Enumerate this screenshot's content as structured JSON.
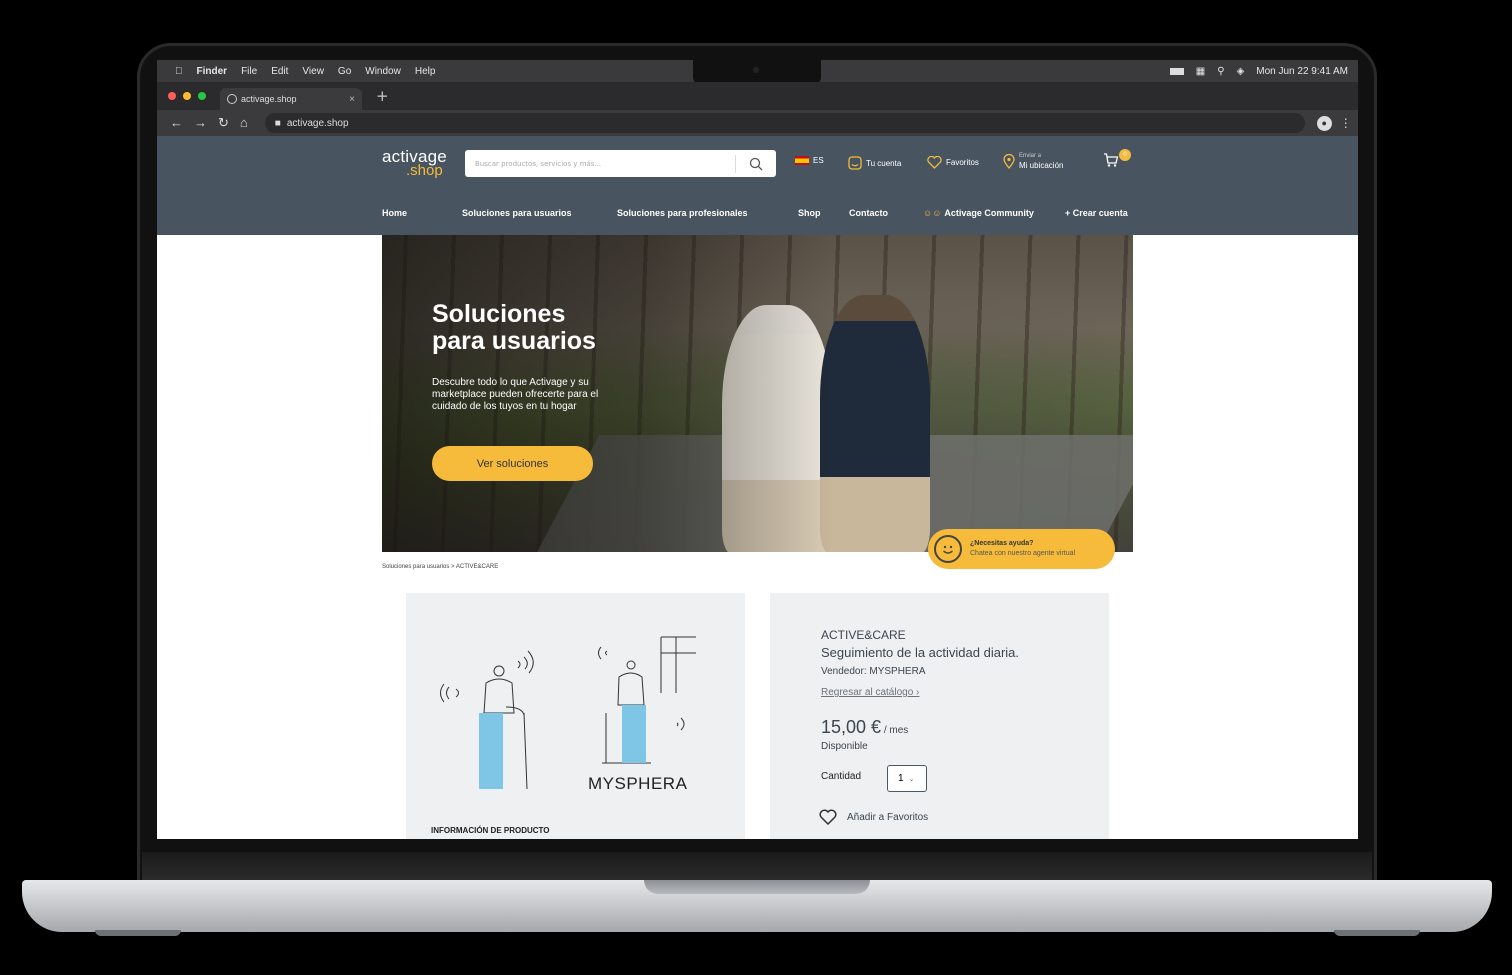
{
  "mac_menubar": {
    "app": "Finder",
    "menus": [
      "File",
      "Edit",
      "View",
      "Go",
      "Window",
      "Help"
    ],
    "clock": "Mon Jun 22  9:41 AM"
  },
  "browser": {
    "tab_title": "activage.shop",
    "url": "activage.shop"
  },
  "site": {
    "logo_line1": "activage",
    "logo_line2": ".shop",
    "search_placeholder": "Buscar productos, servicios y más...",
    "lang": "ES",
    "account": "Tu cuenta",
    "favorites": "Favoritos",
    "location_small": "Enviar a",
    "location": "Mi ubicación",
    "cart_count": "0",
    "nav": [
      "Home",
      "Soluciones para usuarios",
      "Soluciones para profesionales",
      "Shop",
      "Contacto",
      "Activage Community",
      "+ Crear cuenta"
    ]
  },
  "hero": {
    "title_line1": "Soluciones",
    "title_line2": "para usuarios",
    "description": "Descubre todo lo que Activage y su marketplace pueden ofrecerte para el cuidado de los tuyos en tu hogar",
    "cta": "Ver soluciones"
  },
  "help_widget": {
    "title": "¿Necesitas ayuda?",
    "subtitle": "Chatea con nuestro agente virtual"
  },
  "breadcrumb": "Soluciones para usuarios > ACTIVE&CARE",
  "product": {
    "brand_logo": "MYSPHERA",
    "info_heading": "INFORMACIÓN DE PRODUCTO",
    "name": "ACTIVE&CARE",
    "subtitle": "Seguimiento de la actividad diaria.",
    "vendor": "Vendedor: MYSPHERA",
    "back_link": "Regresar al catálogo ›",
    "price": "15,00 €",
    "price_unit": " / mes",
    "availability": "Disponible",
    "quantity_label": "Cantidad",
    "quantity_value": "1",
    "add_favorites": "Añadir a Favoritos"
  },
  "colors": {
    "header_bg": "#485460",
    "accent_yellow": "#f6bb3a",
    "card_bg": "#eef0f1",
    "text_dark": "#3c4650"
  }
}
